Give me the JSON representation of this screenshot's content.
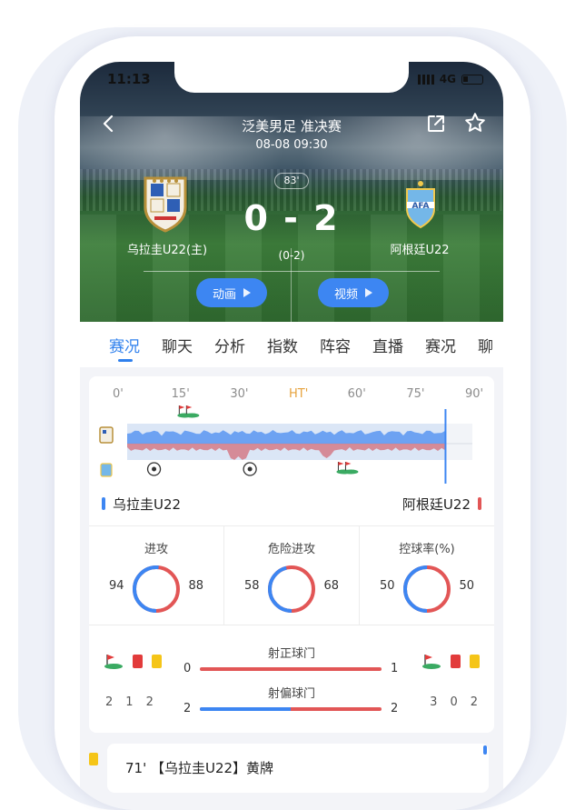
{
  "status_bar": {
    "time": "11:13",
    "network": "4G"
  },
  "header": {
    "league": "泛美男足 准决赛",
    "kickoff": "08-08 09:30",
    "minute": "83'",
    "score": "0 - 2",
    "half_time_score": "(0-2)",
    "home_team": "乌拉圭U22(主)",
    "away_team": "阿根廷U22",
    "animation_label": "动画",
    "video_label": "视频"
  },
  "tabs": [
    "赛况",
    "聊天",
    "分析",
    "指数",
    "阵容",
    "直播",
    "赛况",
    "聊"
  ],
  "active_tab_index": 0,
  "timeline": {
    "ticks": [
      "0'",
      "15'",
      "30'",
      "HT'",
      "60'",
      "75'",
      "90'"
    ],
    "current_minute": 83,
    "home_goals": [
      7,
      32
    ],
    "away_corner_minutes": [
      15
    ],
    "away_corner2_minutes": [
      56
    ]
  },
  "teams": {
    "home": "乌拉圭U22",
    "away": "阿根廷U22"
  },
  "stats": [
    {
      "title": "进攻",
      "home": 94,
      "away": 88
    },
    {
      "title": "危险进攻",
      "home": 58,
      "away": 68
    },
    {
      "title": "控球率(%)",
      "home": 50,
      "away": 50
    }
  ],
  "bar_stats": [
    {
      "title": "射正球门",
      "home": 0,
      "away": 1
    },
    {
      "title": "射偏球门",
      "home": 2,
      "away": 2
    }
  ],
  "home_events": {
    "corners": 2,
    "red_cards": 1,
    "yellow_cards": 2
  },
  "away_events": {
    "corners": 3,
    "red_cards": 0,
    "yellow_cards": 2
  },
  "event": {
    "text": "71' 【乌拉圭U22】黄牌"
  },
  "colors": {
    "home": "#3d86f2",
    "away": "#e25656",
    "accent": "#2f80ed",
    "ht": "#e6a23c"
  }
}
